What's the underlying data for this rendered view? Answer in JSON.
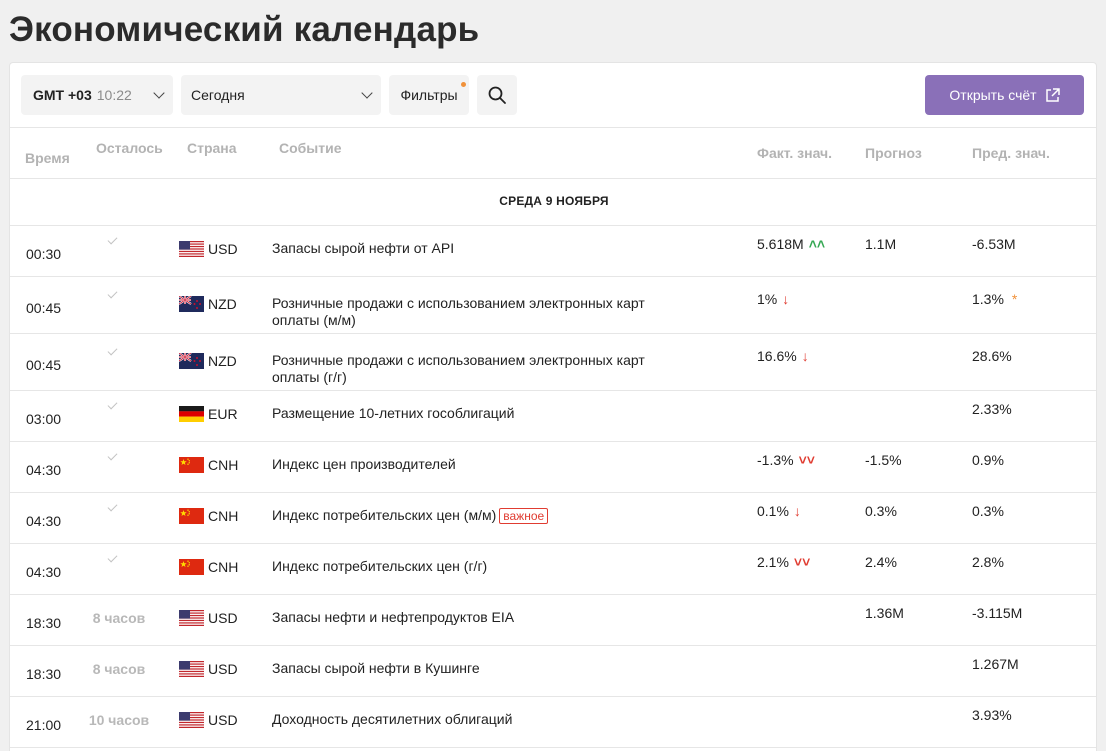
{
  "page_title": "Экономический календарь",
  "toolbar": {
    "timezone_label": "GMT +03",
    "timezone_time": "10:22",
    "day": "Сегодня",
    "filters": "Фильтры",
    "open_account": "Открыть счёт"
  },
  "columns": {
    "time": "Время",
    "left": "Осталось",
    "country": "Страна",
    "event": "Событие",
    "actual": "Факт. знач.",
    "forecast": "Прогноз",
    "previous": "Пред. знач."
  },
  "date_header": "СРЕДА 9 НОЯБРЯ",
  "badge_important": "важное",
  "icons": {
    "search": "search-icon",
    "external": "external-link-icon",
    "check": "check-icon",
    "up": "double-up-arrow-icon",
    "down": "down-arrow-icon",
    "double_down": "double-down-arrow-icon",
    "star": "star-icon"
  },
  "colors": {
    "accent": "#8a70b8",
    "positive": "#35a853",
    "negative": "#e03c31",
    "warning": "#f0913a"
  },
  "events": [
    {
      "time": "00:30",
      "left": "",
      "currency": "USD",
      "flag": "us",
      "event": "Запасы сырой нефти от API",
      "actual": "5.618M",
      "actual_dir": "double-up",
      "forecast": "1.1M",
      "previous": "-6.53M",
      "prev_star": false,
      "important": false
    },
    {
      "time": "00:45",
      "left": "",
      "currency": "NZD",
      "flag": "nz",
      "event": "Розничные продажи с использованием электронных карт оплаты (м/м)",
      "actual": "1%",
      "actual_dir": "down",
      "forecast": "",
      "previous": "1.3%",
      "prev_star": true,
      "important": false
    },
    {
      "time": "00:45",
      "left": "",
      "currency": "NZD",
      "flag": "nz",
      "event": "Розничные продажи с использованием электронных карт оплаты (г/г)",
      "actual": "16.6%",
      "actual_dir": "down",
      "forecast": "",
      "previous": "28.6%",
      "prev_star": false,
      "important": false
    },
    {
      "time": "03:00",
      "left": "",
      "currency": "EUR",
      "flag": "de",
      "event": "Размещение 10-летних гособлигаций",
      "actual": "",
      "actual_dir": "",
      "forecast": "",
      "previous": "2.33%",
      "prev_star": false,
      "important": false
    },
    {
      "time": "04:30",
      "left": "",
      "currency": "CNH",
      "flag": "cn",
      "event": "Индекс цен производителей",
      "actual": "-1.3%",
      "actual_dir": "double-down",
      "forecast": "-1.5%",
      "previous": "0.9%",
      "prev_star": false,
      "important": false
    },
    {
      "time": "04:30",
      "left": "",
      "currency": "CNH",
      "flag": "cn",
      "event": "Индекс потребительских цен (м/м)",
      "actual": "0.1%",
      "actual_dir": "down",
      "forecast": "0.3%",
      "previous": "0.3%",
      "prev_star": false,
      "important": true
    },
    {
      "time": "04:30",
      "left": "",
      "currency": "CNH",
      "flag": "cn",
      "event": "Индекс потребительских цен (г/г)",
      "actual": "2.1%",
      "actual_dir": "double-down",
      "forecast": "2.4%",
      "previous": "2.8%",
      "prev_star": false,
      "important": false
    },
    {
      "time": "18:30",
      "left": "8 часов",
      "currency": "USD",
      "flag": "us",
      "event": "Запасы нефти и нефтепродуктов EIA",
      "actual": "",
      "actual_dir": "",
      "forecast": "1.36M",
      "previous": "-3.115M",
      "prev_star": false,
      "important": false
    },
    {
      "time": "18:30",
      "left": "8 часов",
      "currency": "USD",
      "flag": "us",
      "event": "Запасы сырой нефти в Кушинге",
      "actual": "",
      "actual_dir": "",
      "forecast": "",
      "previous": "1.267M",
      "prev_star": false,
      "important": false
    },
    {
      "time": "21:00",
      "left": "10 часов",
      "currency": "USD",
      "flag": "us",
      "event": "Доходность десятилетних облигаций",
      "actual": "",
      "actual_dir": "",
      "forecast": "",
      "previous": "3.93%",
      "prev_star": false,
      "important": false
    }
  ]
}
